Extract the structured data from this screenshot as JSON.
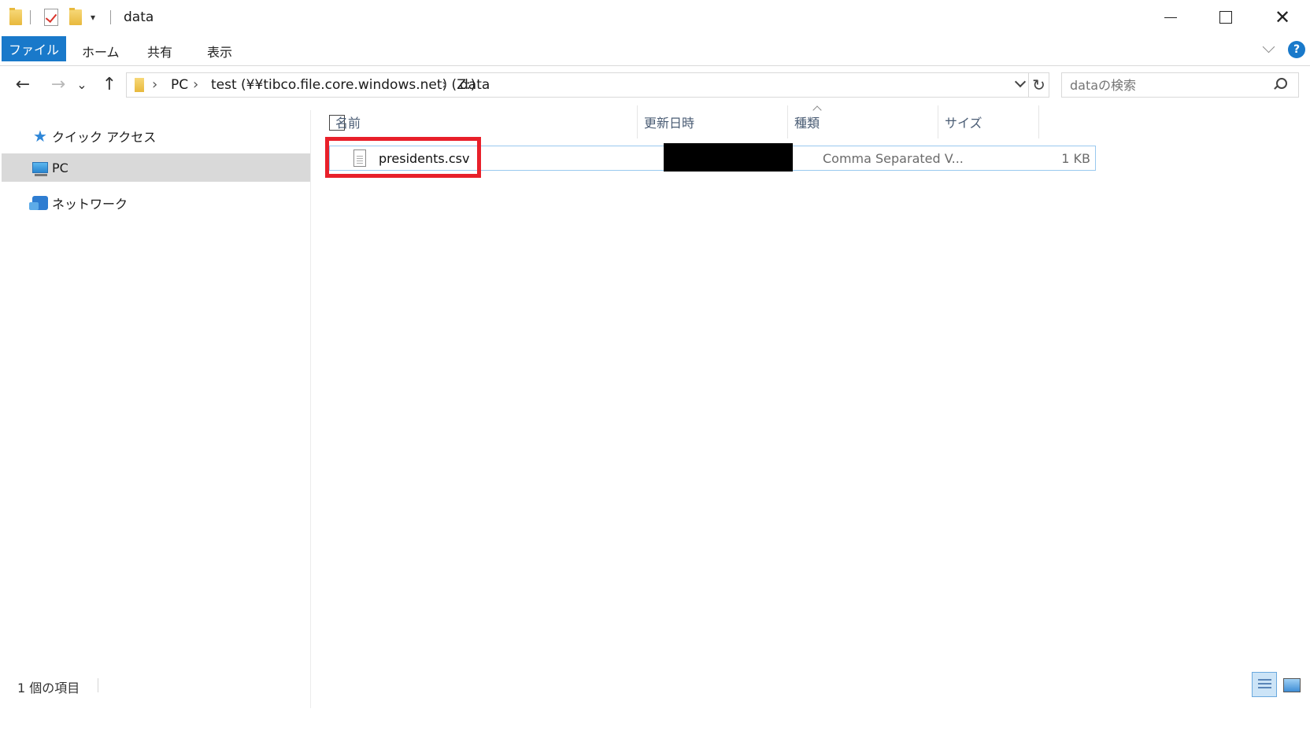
{
  "window": {
    "title": "data",
    "minimize_label": "",
    "maximize_label": "",
    "close_symbol": "✕"
  },
  "ribbon": {
    "file_tab": "ファイル",
    "tabs": [
      "ホーム",
      "共有",
      "表示"
    ],
    "help_symbol": "?"
  },
  "navigation": {
    "back_symbol": "←",
    "forward_symbol": "→",
    "recent_symbol": "⌄",
    "up_symbol": "↑"
  },
  "address": {
    "breadcrumbs": [
      "PC",
      "test (¥¥tibco.file.core.windows.net) (Z:)",
      "data"
    ],
    "separator": "›",
    "refresh_symbol": "↻"
  },
  "search": {
    "placeholder": "dataの検索"
  },
  "nav_pane": {
    "items": [
      {
        "label": "クイック アクセス",
        "icon": "star-icon"
      },
      {
        "label": "PC",
        "icon": "pc-icon",
        "selected": true
      },
      {
        "label": "ネットワーク",
        "icon": "network-icon"
      }
    ]
  },
  "columns": {
    "name": "名前",
    "modified": "更新日時",
    "type": "種類",
    "size": "サイズ"
  },
  "files": [
    {
      "name": "presidents.csv",
      "modified": "",
      "type": "Comma Separated V...",
      "size": "1 KB"
    }
  ],
  "status": {
    "item_count": "1 個の項目"
  },
  "colors": {
    "accent": "#1979ca",
    "highlight_border": "#e8202a",
    "selection_border": "#99c9ef"
  }
}
